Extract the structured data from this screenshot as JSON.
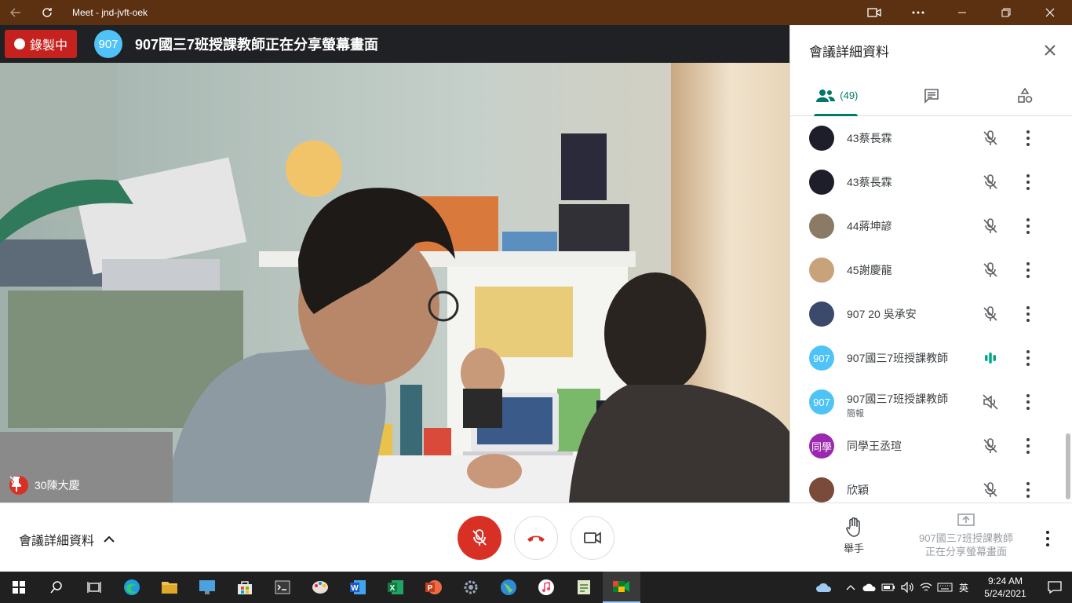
{
  "window": {
    "title": "Meet - jnd-jvft-oek"
  },
  "meeting": {
    "recording_label": "錄製中",
    "presenter_avatar": "907",
    "presenting_text": "907國三7班授課教師正在分享螢幕畫面",
    "video_name": "30陳大慶"
  },
  "panel": {
    "title": "會議詳細資料",
    "people_count": "(49)",
    "participants": [
      {
        "name": "43蔡長霖",
        "avatar": "",
        "avatar_color": "#1e1e2a",
        "mic": "muted"
      },
      {
        "name": "43蔡長霖",
        "avatar": "",
        "avatar_color": "#1e1e2a",
        "mic": "muted"
      },
      {
        "name": "44蔣坤諺",
        "avatar": "",
        "avatar_color": "#8a7a66",
        "mic": "muted"
      },
      {
        "name": "45謝慶龍",
        "avatar": "",
        "avatar_color": "#c7a27a",
        "mic": "muted"
      },
      {
        "name": "907 20 吳承安",
        "avatar": "",
        "avatar_color": "#3b4a6b",
        "mic": "muted"
      },
      {
        "name": "907國三7班授課教師",
        "avatar": "907",
        "avatar_color": "#4fc3f7",
        "mic": "speaking"
      },
      {
        "name": "907國三7班授課教師",
        "sub": "簡報",
        "avatar": "907",
        "avatar_color": "#4fc3f7",
        "mic": "audio-off"
      },
      {
        "name": "同學王丞瑄",
        "avatar": "同學",
        "avatar_color": "#9c27b0",
        "mic": "muted"
      },
      {
        "name": "欣穎",
        "avatar": "",
        "avatar_color": "#7a4a3a",
        "mic": "muted"
      }
    ]
  },
  "controls": {
    "details_label": "會議詳細資料",
    "raise_hand": "舉手",
    "presenting_line1": "907國三7班授課教師",
    "presenting_line2": "正在分享螢幕畫面"
  },
  "taskbar": {
    "time": "9:24 AM",
    "date": "5/24/2021",
    "ime": "英"
  },
  "colors": {
    "accent": "#00796b",
    "record": "#c5221f",
    "titlebar": "#5b3112"
  }
}
